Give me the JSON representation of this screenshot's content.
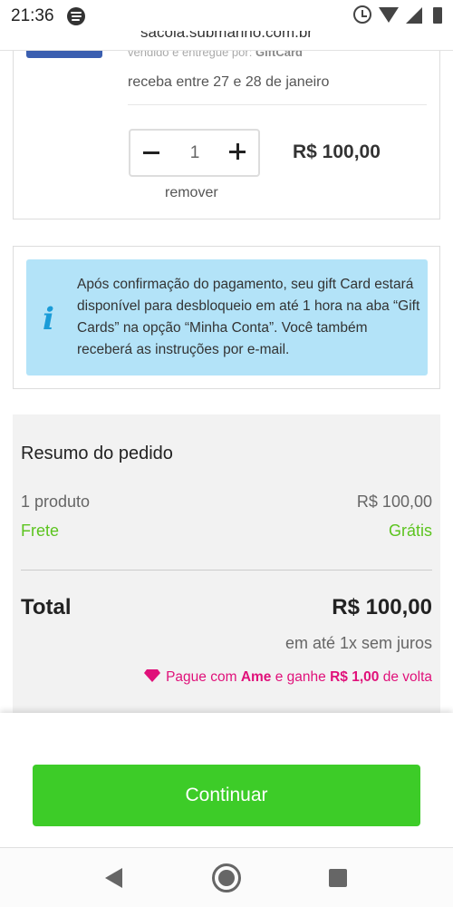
{
  "status_bar": {
    "time": "21:36"
  },
  "browser": {
    "url": "sacola.submarino.com.br"
  },
  "product": {
    "sold_by_prefix": "vendido e entregue por:",
    "seller": "GiftCard",
    "delivery": "receba entre 27 e 28 de janeiro",
    "quantity": "1",
    "price": "R$ 100,00",
    "remove_label": "remover"
  },
  "info": {
    "text": "Após confirmação do pagamento, seu gift Card estará disponível para desbloqueio em até 1 hora na aba “Gift Cards” na opção “Minha Conta”. Você também receberá as instruções por e-mail."
  },
  "summary": {
    "title": "Resumo do pedido",
    "products_label": "1 produto",
    "products_value": "R$ 100,00",
    "shipping_label": "Frete",
    "shipping_value": "Grátis",
    "total_label": "Total",
    "total_value": "R$ 100,00",
    "installments": "em até 1x sem juros",
    "ame": {
      "prefix": "Pague com",
      "brand": "Ame",
      "middle": "e ganhe",
      "cashback": "R$ 1,00",
      "suffix": "de volta"
    }
  },
  "actions": {
    "continue_label": "Continuar"
  },
  "colors": {
    "accent_green": "#3dcc28",
    "ame_pink": "#e0117a",
    "info_blue": "#b3e3f8"
  },
  "icons": [
    "spotify-icon",
    "alarm-icon",
    "wifi-icon",
    "signal-icon",
    "battery-icon",
    "minus-icon",
    "plus-icon",
    "info-icon",
    "diamond-icon",
    "back-icon",
    "home-icon",
    "recent-apps-icon"
  ]
}
